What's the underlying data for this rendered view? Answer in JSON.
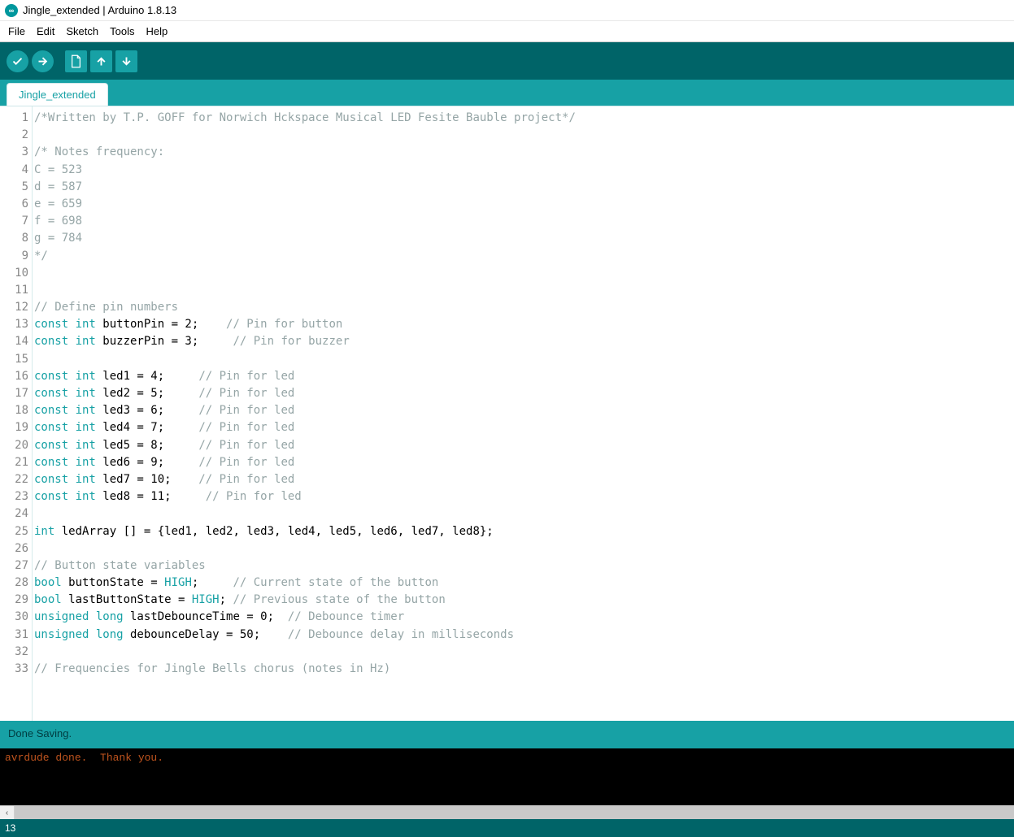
{
  "window": {
    "title": "Jingle_extended | Arduino 1.8.13"
  },
  "menu": {
    "items": [
      "File",
      "Edit",
      "Sketch",
      "Tools",
      "Help"
    ]
  },
  "tabs": {
    "active": "Jingle_extended"
  },
  "toolbar": {
    "verify": "Verify",
    "upload": "Upload",
    "new": "New",
    "open": "Open",
    "save": "Save"
  },
  "code_lines": [
    {
      "n": 1,
      "t": "comment",
      "text": "/*Written by T.P. GOFF for Norwich Hckspace Musical LED Fesite Bauble project*/"
    },
    {
      "n": 2,
      "t": "blank",
      "text": ""
    },
    {
      "n": 3,
      "t": "comment",
      "text": "/* Notes frequency:"
    },
    {
      "n": 4,
      "t": "comment",
      "text": "C = 523"
    },
    {
      "n": 5,
      "t": "comment",
      "text": "d = 587"
    },
    {
      "n": 6,
      "t": "comment",
      "text": "e = 659"
    },
    {
      "n": 7,
      "t": "comment",
      "text": "f = 698"
    },
    {
      "n": 8,
      "t": "comment",
      "text": "g = 784"
    },
    {
      "n": 9,
      "t": "comment",
      "text": "*/"
    },
    {
      "n": 10,
      "t": "blank",
      "text": ""
    },
    {
      "n": 11,
      "t": "blank",
      "text": ""
    },
    {
      "n": 12,
      "t": "comment",
      "text": "// Define pin numbers"
    },
    {
      "n": 13,
      "t": "decl",
      "kw": "const int",
      "ident": " buttonPin = 2;",
      "pad": "    ",
      "cm": "// Pin for button"
    },
    {
      "n": 14,
      "t": "decl",
      "kw": "const int",
      "ident": " buzzerPin = 3;",
      "pad": "     ",
      "cm": "// Pin for buzzer"
    },
    {
      "n": 15,
      "t": "blank",
      "text": ""
    },
    {
      "n": 16,
      "t": "decl",
      "kw": "const int",
      "ident": " led1 = 4;",
      "pad": "     ",
      "cm": "// Pin for led"
    },
    {
      "n": 17,
      "t": "decl",
      "kw": "const int",
      "ident": " led2 = 5;",
      "pad": "     ",
      "cm": "// Pin for led"
    },
    {
      "n": 18,
      "t": "decl",
      "kw": "const int",
      "ident": " led3 = 6;",
      "pad": "     ",
      "cm": "// Pin for led"
    },
    {
      "n": 19,
      "t": "decl",
      "kw": "const int",
      "ident": " led4 = 7;",
      "pad": "     ",
      "cm": "// Pin for led"
    },
    {
      "n": 20,
      "t": "decl",
      "kw": "const int",
      "ident": " led5 = 8;",
      "pad": "     ",
      "cm": "// Pin for led"
    },
    {
      "n": 21,
      "t": "decl",
      "kw": "const int",
      "ident": " led6 = 9;",
      "pad": "     ",
      "cm": "// Pin for led"
    },
    {
      "n": 22,
      "t": "decl",
      "kw": "const int",
      "ident": " led7 = 10;",
      "pad": "    ",
      "cm": "// Pin for led"
    },
    {
      "n": 23,
      "t": "decl",
      "kw": "const int",
      "ident": " led8 = 11;",
      "pad": "     ",
      "cm": "// Pin for led"
    },
    {
      "n": 24,
      "t": "blank",
      "text": ""
    },
    {
      "n": 25,
      "t": "declplain",
      "kw": "int",
      "ident": " ledArray [] = {led1, led2, led3, led4, led5, led6, led7, led8};"
    },
    {
      "n": 26,
      "t": "blank",
      "text": ""
    },
    {
      "n": 27,
      "t": "comment",
      "text": "// Button state variables"
    },
    {
      "n": 28,
      "t": "declconst",
      "kw": "bool",
      "ident": " buttonState = ",
      "cst": "HIGH",
      "rest": ";     ",
      "cm": "// Current state of the button"
    },
    {
      "n": 29,
      "t": "declconst",
      "kw": "bool",
      "ident": " lastButtonState = ",
      "cst": "HIGH",
      "rest": "; ",
      "cm": "// Previous state of the button"
    },
    {
      "n": 30,
      "t": "decl",
      "kw": "unsigned long",
      "ident": " lastDebounceTime = 0;",
      "pad": "  ",
      "cm": "// Debounce timer"
    },
    {
      "n": 31,
      "t": "decl",
      "kw": "unsigned long",
      "ident": " debounceDelay = 50;",
      "pad": "    ",
      "cm": "// Debounce delay in milliseconds"
    },
    {
      "n": 32,
      "t": "blank",
      "text": ""
    },
    {
      "n": 33,
      "t": "comment",
      "text": "// Frequencies for Jingle Bells chorus (notes in Hz)"
    }
  ],
  "status": {
    "message": "Done Saving."
  },
  "console": {
    "line1": "avrdude done.  Thank you."
  },
  "footer": {
    "line_indicator": "13"
  }
}
